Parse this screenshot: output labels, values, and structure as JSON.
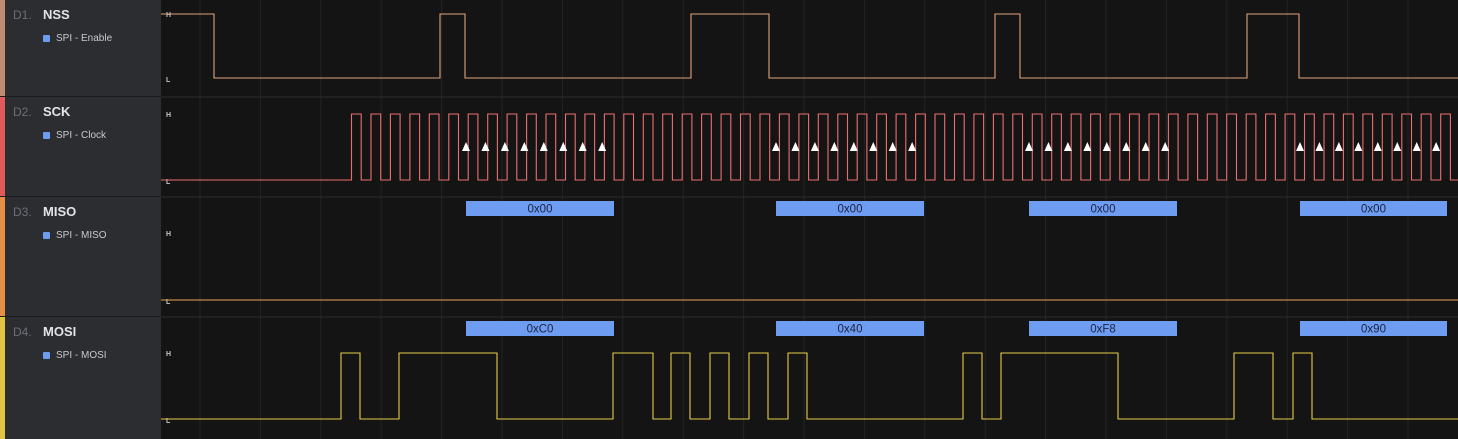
{
  "channels": [
    {
      "index": "D1.",
      "name": "NSS",
      "analyzer": "SPI - Enable",
      "color": "#c08b70",
      "wave": "#e0a27a"
    },
    {
      "index": "D2.",
      "name": "SCK",
      "analyzer": "SPI - Clock",
      "color": "#e05a5a",
      "wave": "#ec6e6e"
    },
    {
      "index": "D3.",
      "name": "MISO",
      "analyzer": "SPI - MISO",
      "color": "#e78d45",
      "wave": "#e9a357"
    },
    {
      "index": "D4.",
      "name": "MOSI",
      "analyzer": "SPI - MOSI",
      "color": "#e0c640",
      "wave": "#e6cc4a"
    }
  ],
  "level_labels": {
    "high": "H",
    "low": "L"
  },
  "colors": {
    "frame_box": "#6e9cf0",
    "frame_text": "#1b2340",
    "arrow": "#ffffff",
    "analyzer_dot": "#6e9cf0"
  },
  "frames": {
    "miso": [
      "0x00",
      "0x00",
      "0x00",
      "0x00"
    ],
    "mosi": [
      "0xC0",
      "0x40",
      "0xF8",
      "0x90"
    ]
  }
}
